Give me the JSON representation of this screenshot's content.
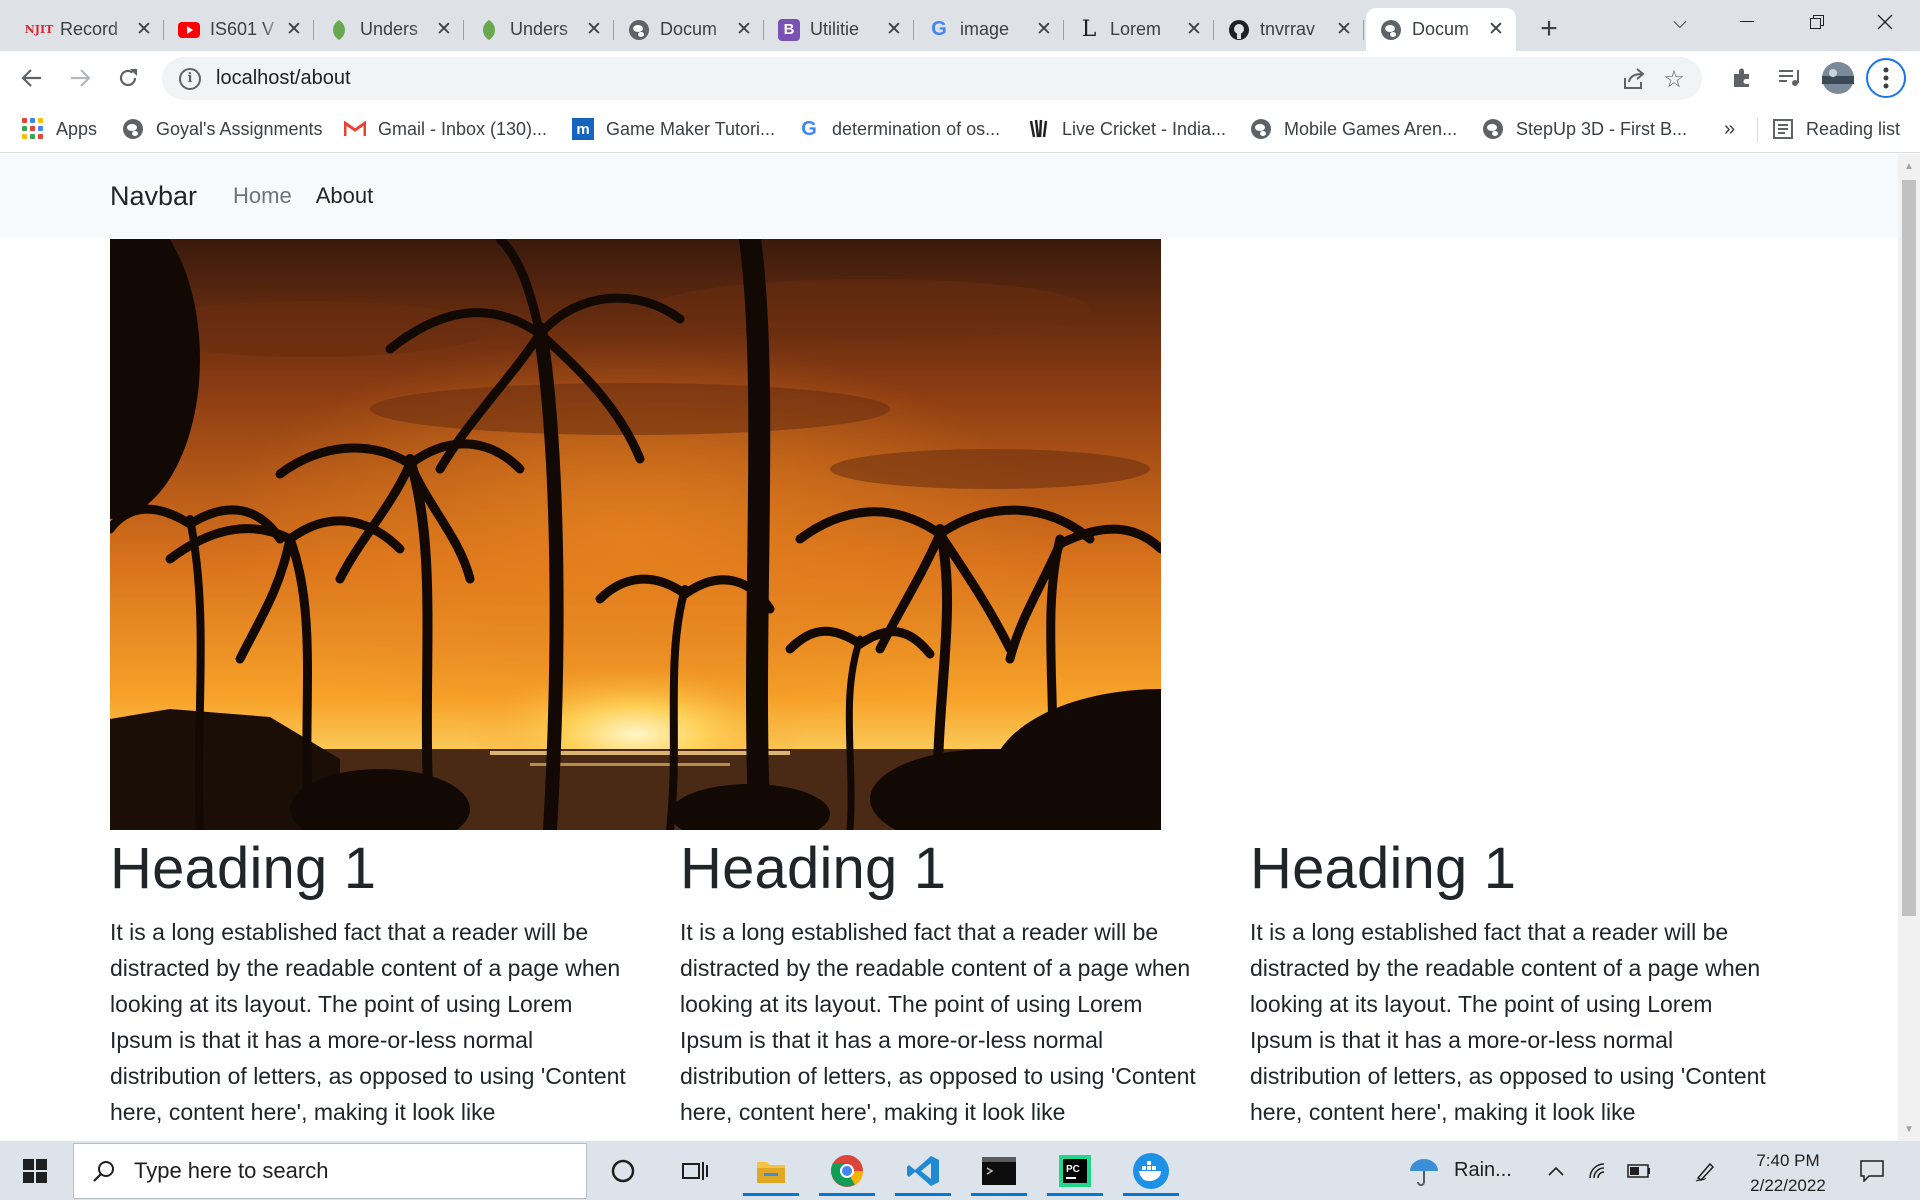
{
  "browser": {
    "tabs": [
      {
        "title": "Record",
        "favicon": "njit-icon",
        "color": "#d7262f"
      },
      {
        "title": "IS601 V",
        "favicon": "youtube-icon",
        "color": "#ff0000"
      },
      {
        "title": "Unders",
        "favicon": "leaf-icon",
        "color": "#4caf50"
      },
      {
        "title": "Unders",
        "favicon": "leaf-icon",
        "color": "#4caf50"
      },
      {
        "title": "Docum",
        "favicon": "globe-icon",
        "color": "#5f6368"
      },
      {
        "title": "Utilitie",
        "favicon": "bootstrap-icon",
        "color": "#7952b3"
      },
      {
        "title": "image",
        "favicon": "google-icon",
        "color": "#4285f4"
      },
      {
        "title": "Lorem",
        "favicon": "lorem-icon",
        "color": "#202124"
      },
      {
        "title": "tnvrrav",
        "favicon": "github-icon",
        "color": "#202124"
      },
      {
        "title": "Docum",
        "favicon": "globe-icon",
        "color": "#5f6368"
      }
    ],
    "active_tab_index": 9,
    "url": "localhost/about",
    "bookmarks": [
      {
        "label": "Apps",
        "icon": "apps-grid-icon"
      },
      {
        "label": "Goyal's Assignments",
        "icon": "globe-icon"
      },
      {
        "label": "Gmail - Inbox (130)...",
        "icon": "gmail-icon"
      },
      {
        "label": "Game Maker Tutori...",
        "icon": "m-icon"
      },
      {
        "label": "determination of os...",
        "icon": "google-icon"
      },
      {
        "label": "Live Cricket - India...",
        "icon": "cricket-icon"
      },
      {
        "label": "Mobile Games Aren...",
        "icon": "globe-icon"
      },
      {
        "label": "StepUp 3D - First B...",
        "icon": "globe-icon"
      }
    ],
    "bookmarks_overflow": "»",
    "reading_list": "Reading list"
  },
  "page": {
    "navbar": {
      "brand": "Navbar",
      "links": [
        {
          "label": "Home",
          "active": false
        },
        {
          "label": "About",
          "active": true
        }
      ]
    },
    "hero_image": "palm-trees-sunset",
    "columns": [
      {
        "heading": "Heading 1",
        "text": "It is a long established fact that a reader will be distracted by the readable content of a page when looking at its layout. The point of using Lorem Ipsum is that it has a more-or-less normal distribution of letters, as opposed to using 'Content here, content here', making it look like"
      },
      {
        "heading": "Heading 1",
        "text": "It is a long established fact that a reader will be distracted by the readable content of a page when looking at its layout. The point of using Lorem Ipsum is that it has a more-or-less normal distribution of letters, as opposed to using 'Content here, content here', making it look like"
      },
      {
        "heading": "Heading 1",
        "text": "It is a long established fact that a reader will be distracted by the readable content of a page when looking at its layout. The point of using Lorem Ipsum is that it has a more-or-less normal distribution of letters, as opposed to using 'Content here, content here', making it look like"
      }
    ]
  },
  "taskbar": {
    "search_placeholder": "Type here to search",
    "weather": "Rain...",
    "time": "7:40 PM",
    "date": "2/22/2022",
    "apps": [
      "file-explorer-icon",
      "chrome-icon",
      "vscode-icon",
      "terminal-icon",
      "pycharm-icon",
      "docker-icon"
    ]
  },
  "colors": {
    "navbar_bg": "#f8f9fa",
    "chrome_tabstrip": "#dee1e6",
    "taskbar_bg": "#dde3ea",
    "accent": "#1a73e8"
  }
}
